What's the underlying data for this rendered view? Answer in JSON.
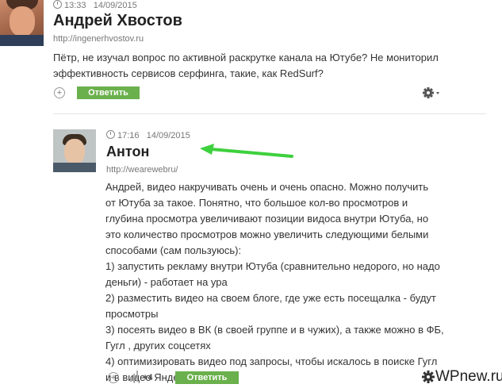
{
  "comment1": {
    "time": "13:33",
    "date": "14/09/2015",
    "author": "Андрей Хвостов",
    "site": "http://ingenerhvostov.ru",
    "text_lines": [
      "Пётр, не изучал вопрос по активной раскрутке канала на Ютубе? Не мониторил",
      "эффективность сервисов серфинга, такие, как RedSurf?"
    ],
    "plus": "+",
    "reply_label": "Ответить",
    "gear": "⚙"
  },
  "comment2": {
    "time": "17:16",
    "date": "14/09/2015",
    "author": "Антон",
    "site": "http://wearewebru/",
    "text_lines": [
      "Андрей, видео накручивать очень и очень опасно. Можно получить",
      "от Ютуба за такое. Понятно, что большое кол-во просмотров и",
      "глубина просмотра увеличивают позиции видоса внутри Ютуба, но",
      "это количество просмотров можно увеличить следующими белыми",
      "способами (сам пользуюсь):",
      "1) запустить рекламу внутри Ютуба (сравнительно недорого, но надо",
      "деньги) - работает на ура",
      "2) разместить видео на своем блоге, где уже есть посещалка - будут",
      "просмотры",
      "3) посеять видео в ВК (в своей группе и в чужих), а также можно в ФБ,",
      "Гугл , других соцсетях",
      "4) оптимизировать видео под запросы, чтобы искалось в поиске Гугл",
      "и в видео Яндекса."
    ],
    "plus": "+",
    "votes": "+4",
    "reply_label": "Ответить"
  },
  "watermark": "WPnew.ru",
  "colors": {
    "reply_button": "#6ab04c",
    "arrow": "#3dd13d"
  }
}
